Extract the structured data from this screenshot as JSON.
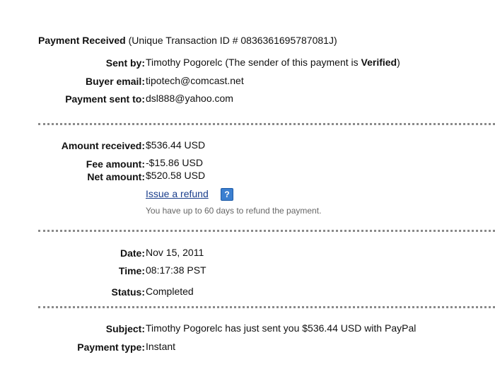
{
  "header": {
    "title": "Payment Received",
    "transaction": "(Unique Transaction ID # 0836361695787081J)"
  },
  "sender": {
    "sent_by_label": "Sent by:",
    "sender_name": "Timothy Pogorelc",
    "verified_prefix": "(The sender of this payment is ",
    "verified_word": "Verified",
    "verified_suffix": ")",
    "buyer_email_label": "Buyer email:",
    "buyer_email": "tipotech@comcast.net",
    "sent_to_label": "Payment sent to:",
    "sent_to": "dsl888@yahoo.com"
  },
  "amounts": {
    "received_label": "Amount received:",
    "received": "$536.44 USD",
    "fee_label": "Fee amount:",
    "fee": "-$15.86 USD",
    "net_label": "Net amount:",
    "net": "$520.58 USD",
    "refund_link": "Issue a refund",
    "help_icon": "question-mark-icon",
    "help_glyph": "?",
    "refund_note": "You have up to 60 days to refund the payment."
  },
  "details": {
    "date_label": "Date:",
    "date": "Nov 15, 2011",
    "time_label": "Time:",
    "time": "08:17:38 PST",
    "status_label": "Status:",
    "status": "Completed"
  },
  "subject": {
    "subject_label": "Subject:",
    "subject": "Timothy Pogorelc has just sent you $536.44 USD with PayPal",
    "type_label": "Payment type:",
    "type": "Instant"
  },
  "colors": {
    "link": "#1a3e8c",
    "help_icon_bg": "#3b7fd0",
    "separator": "#8a8a8a",
    "note": "#666666"
  }
}
